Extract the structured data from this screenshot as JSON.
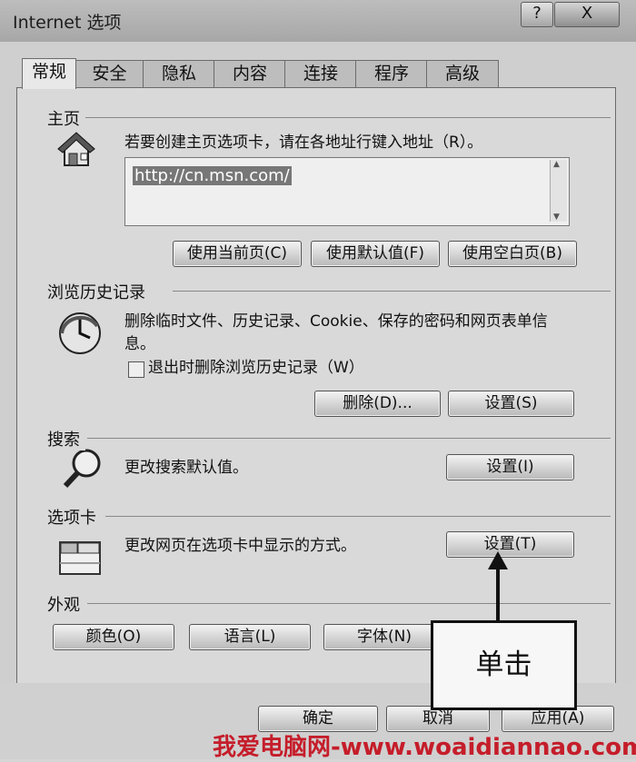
{
  "window": {
    "title": "Internet 选项",
    "help": "?",
    "close": "X"
  },
  "tabs": [
    {
      "label": "常规"
    },
    {
      "label": "安全"
    },
    {
      "label": "隐私"
    },
    {
      "label": "内容"
    },
    {
      "label": "连接"
    },
    {
      "label": "程序"
    },
    {
      "label": "高级"
    }
  ],
  "homepage": {
    "title": "主页",
    "desc": "若要创建主页选项卡，请在各地址行键入地址（R）。",
    "url": "http://cn.msn.com/",
    "buttons": [
      "使用当前页(C)",
      "使用默认值(F)",
      "使用空白页(B)"
    ]
  },
  "history": {
    "title": "浏览历史记录",
    "desc": "删除临时文件、历史记录、Cookie、保存的密码和网页表单信息。",
    "checkbox_label": "退出时删除浏览历史记录（W）",
    "delete": "删除(D)...",
    "settings": "设置(S)"
  },
  "search": {
    "title": "搜索",
    "desc": "更改搜索默认值。",
    "settings": "设置(I)"
  },
  "tabsSection": {
    "title": "选项卡",
    "desc": "更改网页在选项卡中显示的方式。",
    "settings": "设置(T)"
  },
  "appearance": {
    "title": "外观",
    "colors": "颜色(O)",
    "languages": "语言(L)",
    "fonts": "字体(N)"
  },
  "footer": {
    "ok": "确定",
    "cancel": "取消",
    "apply": "应用(A)"
  },
  "annotation": {
    "callout": "单击",
    "watermark": "我爱电脑网-www.woaidiannao.com"
  }
}
